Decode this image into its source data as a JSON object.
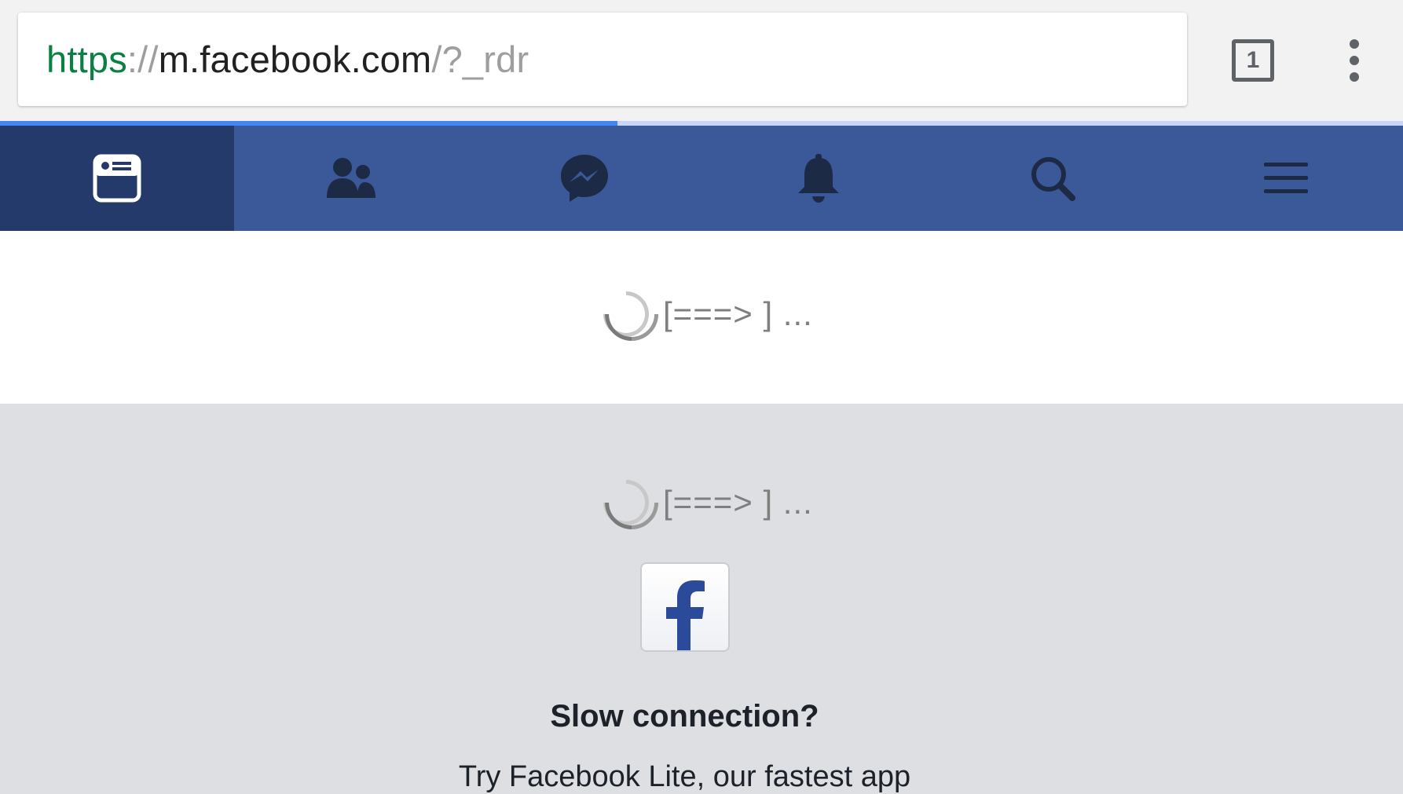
{
  "browser": {
    "url": {
      "scheme": "https",
      "separator": "://",
      "host": "m.facebook.com",
      "path": "/?_rdr"
    },
    "tab_count": "1",
    "load_progress": 0.44
  },
  "nav": {
    "tabs": [
      {
        "id": "news-feed",
        "icon": "news-feed-icon",
        "active": true
      },
      {
        "id": "friend-requests",
        "icon": "friends-icon",
        "active": false
      },
      {
        "id": "messages",
        "icon": "messenger-icon",
        "active": false
      },
      {
        "id": "notifications",
        "icon": "bell-icon",
        "active": false
      },
      {
        "id": "search",
        "icon": "search-icon",
        "active": false
      },
      {
        "id": "menu",
        "icon": "hamburger-icon",
        "active": false
      }
    ]
  },
  "loaders": {
    "top_text": "[===> ] ...",
    "bottom_text": "[===> ] ..."
  },
  "promo": {
    "logo_icon": "facebook-lite-logo",
    "title": "Slow connection?",
    "subtitle": "Try Facebook Lite, our fastest app"
  },
  "colors": {
    "fb_blue": "#3b5998",
    "fb_active": "#233a6a",
    "progress": "#4285f4",
    "secure_scheme": "#0b8043"
  }
}
